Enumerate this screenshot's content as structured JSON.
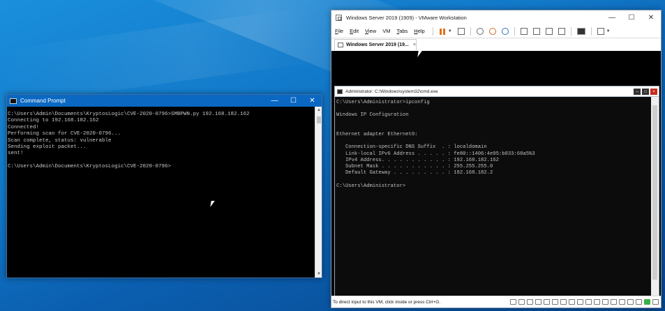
{
  "host_cmd": {
    "title": "Command Prompt",
    "controls": {
      "minimize": "—",
      "maximize": "☐",
      "close": "✕"
    },
    "lines": [
      "C:\\Users\\Admin\\Documents\\KryptosLogic\\CVE-2020-0796>SMBPWN.py 192.168.182.162",
      "Connecting to 192.168.182.162",
      "Connected!",
      "Performing scan for CVE-2020-0796...",
      "Scan complete, status: vulnerable",
      "Sending exploit packet...",
      "sent!",
      "",
      "C:\\Users\\Admin\\Documents\\KryptosLogic\\CVE-2020-0796>"
    ]
  },
  "vmware": {
    "title": "Windows Server 2019 (1909) - VMware Workstation",
    "controls": {
      "minimize": "—",
      "maximize": "☐",
      "close": "✕"
    },
    "menu": [
      "File",
      "Edit",
      "View",
      "VM",
      "Tabs",
      "Help"
    ],
    "tab_label": "Windows Server 2019 (19...",
    "tab_close": "×",
    "status_text": "To direct input to this VM, click inside or press Ctrl+G.",
    "accent_color": "#0a68c2"
  },
  "guest_cmd": {
    "title": "Administrator: C:\\Windows\\system32\\cmd.exe",
    "lines": [
      "C:\\Users\\Administrator>ipconfig",
      "",
      "Windows IP Configuration",
      "",
      "",
      "Ethernet adapter Ethernet0:",
      "",
      "   Connection-specific DNS Suffix  . : localdomain",
      "   Link-local IPv6 Address . . . . . : fe80::1406:4e95:b033:68a5%3",
      "   IPv4 Address. . . . . . . . . . . : 192.168.182.162",
      "   Subnet Mask . . . . . . . . . . . : 255.255.255.0",
      "   Default Gateway . . . . . . . . . : 192.168.182.2",
      "",
      "C:\\Users\\Administrator>"
    ]
  }
}
